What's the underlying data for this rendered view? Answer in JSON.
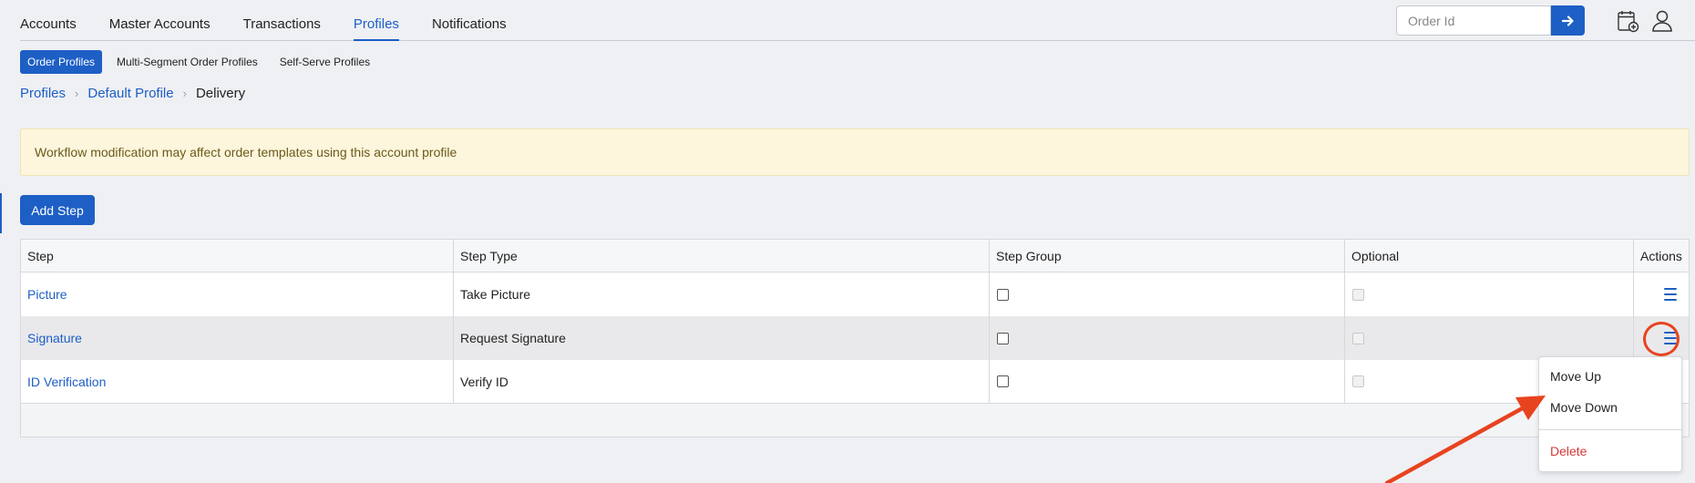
{
  "nav": {
    "tabs": [
      {
        "label": "Accounts"
      },
      {
        "label": "Master Accounts"
      },
      {
        "label": "Transactions"
      },
      {
        "label": "Profiles"
      },
      {
        "label": "Notifications"
      }
    ],
    "active": "Profiles",
    "order_id_placeholder": "Order Id"
  },
  "subtabs": [
    {
      "label": "Order Profiles"
    },
    {
      "label": "Multi-Segment Order Profiles"
    },
    {
      "label": "Self-Serve Profiles"
    }
  ],
  "breadcrumb": {
    "items": [
      "Profiles",
      "Default Profile"
    ],
    "current": "Delivery"
  },
  "alert": {
    "text": "Workflow modification may affect order templates using this account profile"
  },
  "add_step_label": "Add Step",
  "table": {
    "headers": [
      "Step",
      "Step Type",
      "Step Group",
      "Optional",
      "Actions"
    ],
    "rows": [
      {
        "step": "Picture",
        "type": "Take Picture",
        "group_checked": false,
        "optional_checked": false
      },
      {
        "step": "Signature",
        "type": "Request Signature",
        "group_checked": false,
        "optional_checked": false
      },
      {
        "step": "ID Verification",
        "type": "Verify ID",
        "group_checked": false,
        "optional_checked": false
      }
    ]
  },
  "actions_menu": {
    "items": [
      "Move Up",
      "Move Down"
    ],
    "danger_item": "Delete"
  },
  "colors": {
    "accent": "#1d5fc5",
    "annotation": "#e8431f",
    "alert_bg": "#fdf6dd",
    "danger": "#d43a3a"
  },
  "icons": [
    "arrow-right-icon",
    "calendar-add-icon",
    "user-icon",
    "hamburger-menu-icon",
    "chevron-right-icon"
  ]
}
